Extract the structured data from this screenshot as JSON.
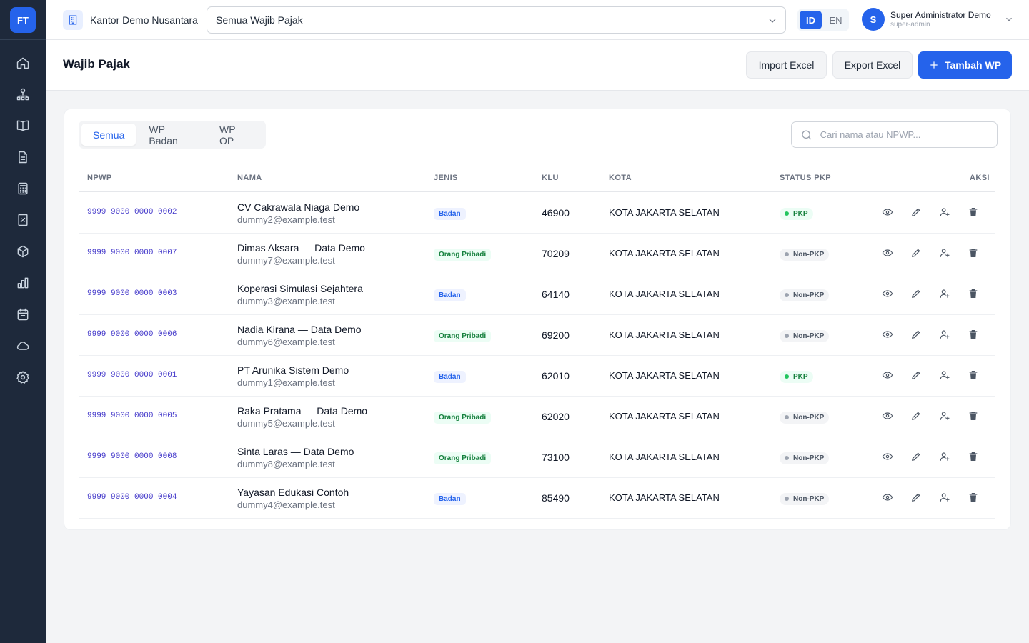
{
  "app": {
    "logo": "FT"
  },
  "sidebar": {
    "items": [
      {
        "icon": "home-icon"
      },
      {
        "icon": "org-chart-icon"
      },
      {
        "icon": "book-icon"
      },
      {
        "icon": "document-icon"
      },
      {
        "icon": "calculator-icon"
      },
      {
        "icon": "receipt-icon"
      },
      {
        "icon": "box-icon"
      },
      {
        "icon": "bar-chart-icon"
      },
      {
        "icon": "calendar-icon"
      },
      {
        "icon": "cloud-icon"
      },
      {
        "icon": "gear-icon"
      }
    ]
  },
  "topbar": {
    "office_name": "Kantor Demo Nusantara",
    "taxpayer_select": "Semua Wajib Pajak",
    "lang": {
      "id": "ID",
      "en": "EN",
      "active": "ID"
    },
    "user": {
      "initial": "S",
      "name": "Super Administrator Demo",
      "role": "super-admin"
    }
  },
  "header": {
    "title": "Wajib Pajak",
    "import_label": "Import Excel",
    "export_label": "Export Excel",
    "add_label": "Tambah WP"
  },
  "filters": {
    "tabs": [
      {
        "label": "Semua"
      },
      {
        "label": "WP Badan"
      },
      {
        "label": "WP OP"
      }
    ],
    "active_tab": "Semua",
    "search_placeholder": "Cari nama atau NPWP..."
  },
  "table": {
    "columns": {
      "npwp": "NPWP",
      "nama": "NAMA",
      "jenis": "JENIS",
      "klu": "KLU",
      "kota": "KOTA",
      "status": "STATUS PKP",
      "aksi": "AKSI"
    },
    "rows": [
      {
        "npwp": "9999 9000 0000 0002",
        "nama": "CV Cakrawala Niaga Demo",
        "email": "dummy2@example.test",
        "jenis": "Badan",
        "klu": "46900",
        "kota": "KOTA JAKARTA SELATAN",
        "status": "PKP"
      },
      {
        "npwp": "9999 9000 0000 0007",
        "nama": "Dimas Aksara — Data Demo",
        "email": "dummy7@example.test",
        "jenis": "Orang Pribadi",
        "klu": "70209",
        "kota": "KOTA JAKARTA SELATAN",
        "status": "Non-PKP"
      },
      {
        "npwp": "9999 9000 0000 0003",
        "nama": "Koperasi Simulasi Sejahtera",
        "email": "dummy3@example.test",
        "jenis": "Badan",
        "klu": "64140",
        "kota": "KOTA JAKARTA SELATAN",
        "status": "Non-PKP"
      },
      {
        "npwp": "9999 9000 0000 0006",
        "nama": "Nadia Kirana — Data Demo",
        "email": "dummy6@example.test",
        "jenis": "Orang Pribadi",
        "klu": "69200",
        "kota": "KOTA JAKARTA SELATAN",
        "status": "Non-PKP"
      },
      {
        "npwp": "9999 9000 0000 0001",
        "nama": "PT Arunika Sistem Demo",
        "email": "dummy1@example.test",
        "jenis": "Badan",
        "klu": "62010",
        "kota": "KOTA JAKARTA SELATAN",
        "status": "PKP"
      },
      {
        "npwp": "9999 9000 0000 0005",
        "nama": "Raka Pratama — Data Demo",
        "email": "dummy5@example.test",
        "jenis": "Orang Pribadi",
        "klu": "62020",
        "kota": "KOTA JAKARTA SELATAN",
        "status": "Non-PKP"
      },
      {
        "npwp": "9999 9000 0000 0008",
        "nama": "Sinta Laras — Data Demo",
        "email": "dummy8@example.test",
        "jenis": "Orang Pribadi",
        "klu": "73100",
        "kota": "KOTA JAKARTA SELATAN",
        "status": "Non-PKP"
      },
      {
        "npwp": "9999 9000 0000 0004",
        "nama": "Yayasan Edukasi Contoh",
        "email": "dummy4@example.test",
        "jenis": "Badan",
        "klu": "85490",
        "kota": "KOTA JAKARTA SELATAN",
        "status": "Non-PKP"
      }
    ]
  },
  "colors": {
    "accent": "#2563eb",
    "sidebar": "#1e293b",
    "pkp": "#22c55e"
  }
}
